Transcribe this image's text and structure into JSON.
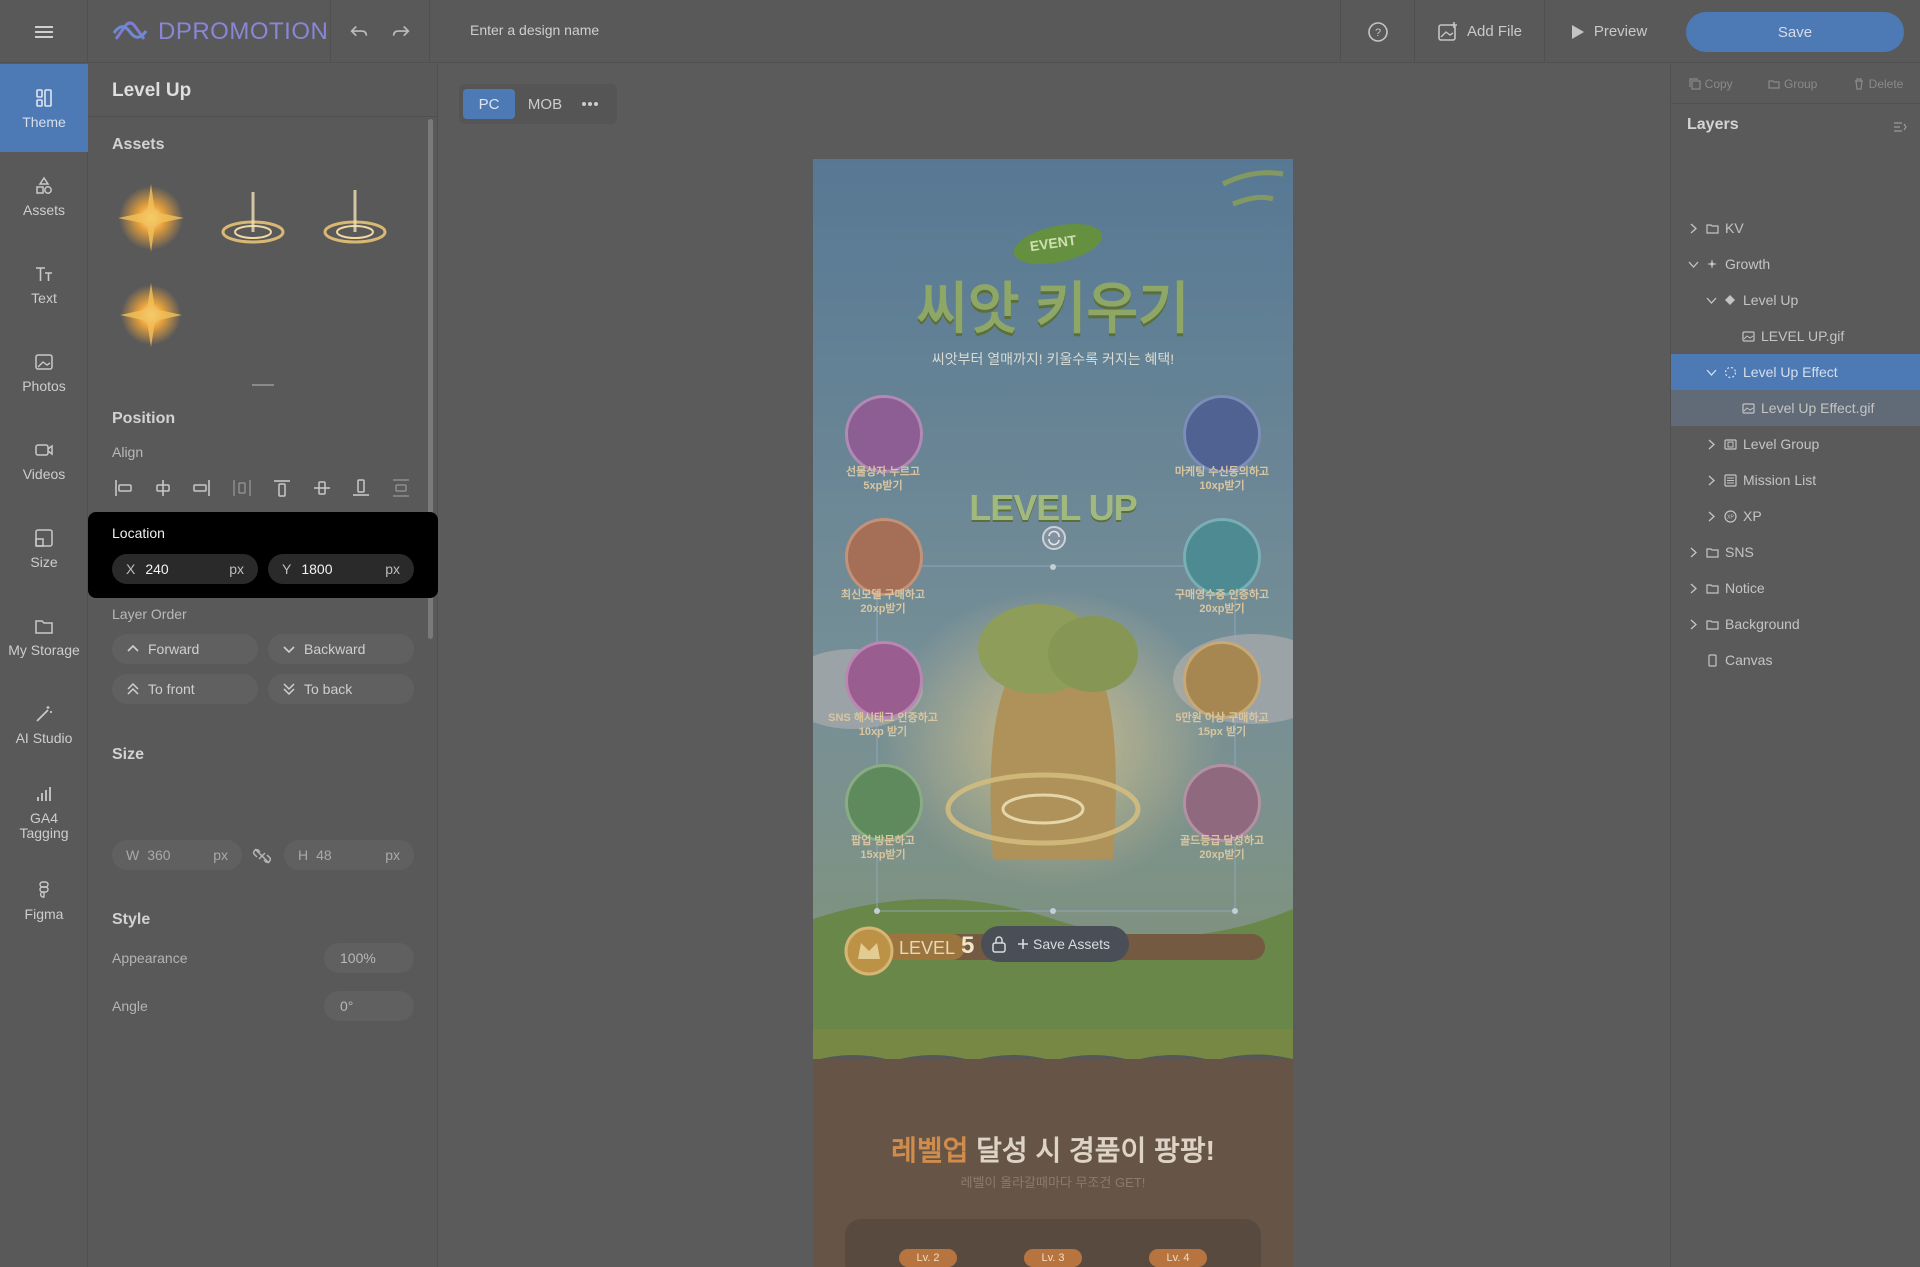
{
  "topbar": {
    "brand": "DPROMOTION",
    "design_name_placeholder": "Enter a design name",
    "help_icon": "question-circle-icon",
    "add_file_label": "Add File",
    "preview_label": "Preview",
    "save_label": "Save"
  },
  "leftnav": {
    "items": [
      {
        "label": "Theme",
        "icon": "layout-icon"
      },
      {
        "label": "Assets",
        "icon": "shapes-icon"
      },
      {
        "label": "Text",
        "icon": "text-icon"
      },
      {
        "label": "Photos",
        "icon": "image-icon"
      },
      {
        "label": "Videos",
        "icon": "video-icon"
      },
      {
        "label": "Size",
        "icon": "resize-icon"
      },
      {
        "label": "My Storage",
        "icon": "folder-icon"
      },
      {
        "label": "AI Studio",
        "icon": "magic-wand-icon"
      },
      {
        "label": "GA4\nTagging",
        "icon": "bar-chart-icon"
      },
      {
        "label": "Figma",
        "icon": "figma-icon"
      }
    ]
  },
  "panel": {
    "title": "Level Up",
    "assets_heading": "Assets",
    "position_heading": "Position",
    "align_label": "Align",
    "location": {
      "title": "Location",
      "x_label": "X",
      "x_value": "240",
      "x_unit": "px",
      "y_label": "Y",
      "y_value": "1800",
      "y_unit": "px"
    },
    "layer_order": {
      "label": "Layer Order",
      "forward": "Forward",
      "backward": "Backward",
      "to_front": "To front",
      "to_back": "To back"
    },
    "size": {
      "heading": "Size",
      "w_label": "W",
      "w_value": "360",
      "w_unit": "px",
      "h_label": "H",
      "h_value": "48",
      "h_unit": "px"
    },
    "style": {
      "heading": "Style",
      "appearance_label": "Appearance",
      "appearance_value": "100%",
      "angle_label": "Angle",
      "angle_value": "0°"
    }
  },
  "canvas": {
    "device_pc": "PC",
    "device_mob": "MOB",
    "event_badge": "EVENT",
    "main_title": "씨앗 키우기",
    "subtitle": "씨앗부터 열매까지! 키울수록 커지는 혜택!",
    "levelup_text": "LEVEL UP",
    "missions_left": [
      {
        "line1": "선물상자 누르고",
        "line2": "5xp받기"
      },
      {
        "line1": "최신모델 구매하고",
        "line2": "20xp받기"
      },
      {
        "line1": "SNS 해시태그 인증하고",
        "line2": "10xp 받기"
      },
      {
        "line1": "팝업 방문하고",
        "line2": "15xp받기"
      }
    ],
    "missions_right": [
      {
        "line1": "마케팅 수신동의하고",
        "line2": "10xp받기"
      },
      {
        "line1": "구매영수증 인증하고",
        "line2": "20xp받기"
      },
      {
        "line1": "5만원 이상 구매하고",
        "line2": "15px 받기"
      },
      {
        "line1": "골드등급 달성하고",
        "line2": "20xp받기"
      }
    ],
    "level_label": "LEVEL",
    "level_number": "5",
    "save_assets_label": "Save Assets",
    "bottom_heading_highlight": "레벨업",
    "bottom_heading_rest": " 달성 시 경품이 팡팡!",
    "bottom_sub": "레벨이 올라갈때마다 무조건 GET!",
    "level_tabs": [
      "Lv. 2",
      "Lv. 3",
      "Lv. 4"
    ]
  },
  "layers": {
    "tools": {
      "copy": "Copy",
      "group": "Group",
      "delete": "Delete"
    },
    "title": "Layers",
    "rows": [
      {
        "label": "KV",
        "indent": 0,
        "icon": "folder-icon",
        "chevron": "right"
      },
      {
        "label": "Growth",
        "indent": 0,
        "icon": "sparkle-icon",
        "chevron": "down"
      },
      {
        "label": "Level Up",
        "indent": 1,
        "icon": "shape-icon",
        "chevron": "down"
      },
      {
        "label": "LEVEL UP.gif",
        "indent": 2,
        "icon": "image-icon",
        "chevron": "none"
      },
      {
        "label": "Level Up Effect",
        "indent": 1,
        "icon": "dashed-circle-icon",
        "chevron": "down",
        "selected": true
      },
      {
        "label": "Level Up Effect.gif",
        "indent": 2,
        "icon": "image-icon",
        "chevron": "none",
        "child_selected": true
      },
      {
        "label": "Level Group",
        "indent": 1,
        "icon": "group-icon",
        "chevron": "right"
      },
      {
        "label": "Mission List",
        "indent": 1,
        "icon": "list-icon",
        "chevron": "right"
      },
      {
        "label": "XP",
        "indent": 1,
        "icon": "xp-icon",
        "chevron": "right"
      },
      {
        "label": "SNS",
        "indent": 0,
        "icon": "folder-icon",
        "chevron": "right"
      },
      {
        "label": "Notice",
        "indent": 0,
        "icon": "folder-icon",
        "chevron": "right"
      },
      {
        "label": "Background",
        "indent": 0,
        "icon": "folder-icon",
        "chevron": "right"
      },
      {
        "label": "Canvas",
        "indent": 0,
        "icon": "canvas-icon",
        "chevron": "none"
      }
    ]
  },
  "colors": {
    "accent": "#4d7ab5",
    "overlay": "#5a5a5a",
    "location_box": "#000000"
  }
}
